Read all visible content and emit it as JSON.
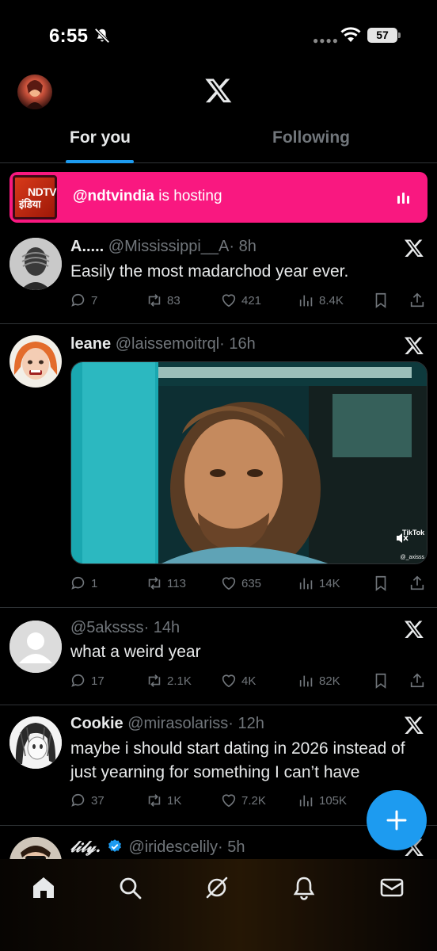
{
  "status_bar": {
    "time": "6:55",
    "battery": "57",
    "icons": [
      "mute-icon",
      "signal-dots-icon",
      "wifi-icon",
      "battery-icon"
    ]
  },
  "header": {
    "logo": "X",
    "tabs": [
      {
        "label": "For you",
        "active": true
      },
      {
        "label": "Following",
        "active": false
      }
    ]
  },
  "spaces_banner": {
    "logo_line1": "NDTV",
    "logo_line2": "इंडिया",
    "host": "@ndtvindia",
    "status": " is hosting",
    "color": "#f91880"
  },
  "tweets": [
    {
      "name": "A.....",
      "handle": "@Mississippi__A",
      "time": "· 8h",
      "text": "Easily the most madarchod year ever.",
      "replies": "7",
      "reposts": "83",
      "likes": "421",
      "views": "8.4K"
    },
    {
      "name": "leane",
      "handle": "@laissemoitrql",
      "time": "· 16h",
      "text": "",
      "media_watermark": "TikTok",
      "media_watermark_user": "@_axisss",
      "replies": "1",
      "reposts": "113",
      "likes": "635",
      "views": "14K"
    },
    {
      "name": "",
      "handle": "@5akssss",
      "time": "· 14h",
      "text": "what a weird year",
      "replies": "17",
      "reposts": "2.1K",
      "likes": "4K",
      "views": "82K"
    },
    {
      "name": "Cookie",
      "handle": "@mirasolariss",
      "time": "· 12h",
      "text_line1": "maybe i should start dating in 2026 instead of",
      "text_line2": "just yearning for something I can’t have",
      "replies": "37",
      "reposts": "1K",
      "likes": "7.2K",
      "views": "105K"
    },
    {
      "name": "𝓁𝒾𝓁𝓎.",
      "handle": "@iridescelily",
      "time": "· 5h",
      "verified": true
    }
  ],
  "bottom_nav": [
    "home-icon",
    "search-icon",
    "grok-icon",
    "notifications-icon",
    "messages-icon"
  ],
  "colors": {
    "accent": "#1d9bf0",
    "background": "#000000",
    "secondary_text": "#71767b",
    "divider": "#2f3336"
  }
}
